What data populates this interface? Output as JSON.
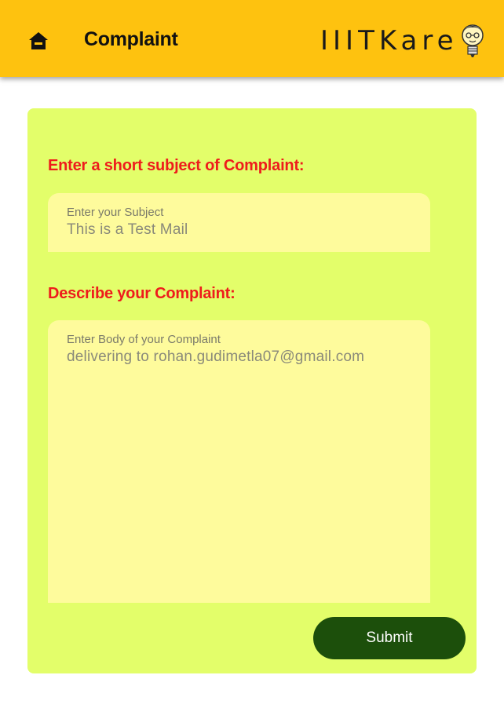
{
  "appbar": {
    "title": "Complaint",
    "brand": "IIITKare",
    "home_icon": "home-icon",
    "logo_icon": "lightbulb-face-icon",
    "background": "#fec20f"
  },
  "form": {
    "subject_label": "Enter a short subject of Complaint:",
    "subject_hint": "Enter your Subject",
    "subject_value": "This is a Test Mail",
    "body_label": "Describe your Complaint:",
    "body_hint": "Enter Body of your Complaint",
    "body_value": "delivering to rohan.gudimetla07@gmail.com",
    "submit_label": "Submit",
    "card_color": "#e3fe6a",
    "field_color": "#fefb9c",
    "label_color": "#ee1c1c",
    "button_color": "#1c4f0b"
  }
}
